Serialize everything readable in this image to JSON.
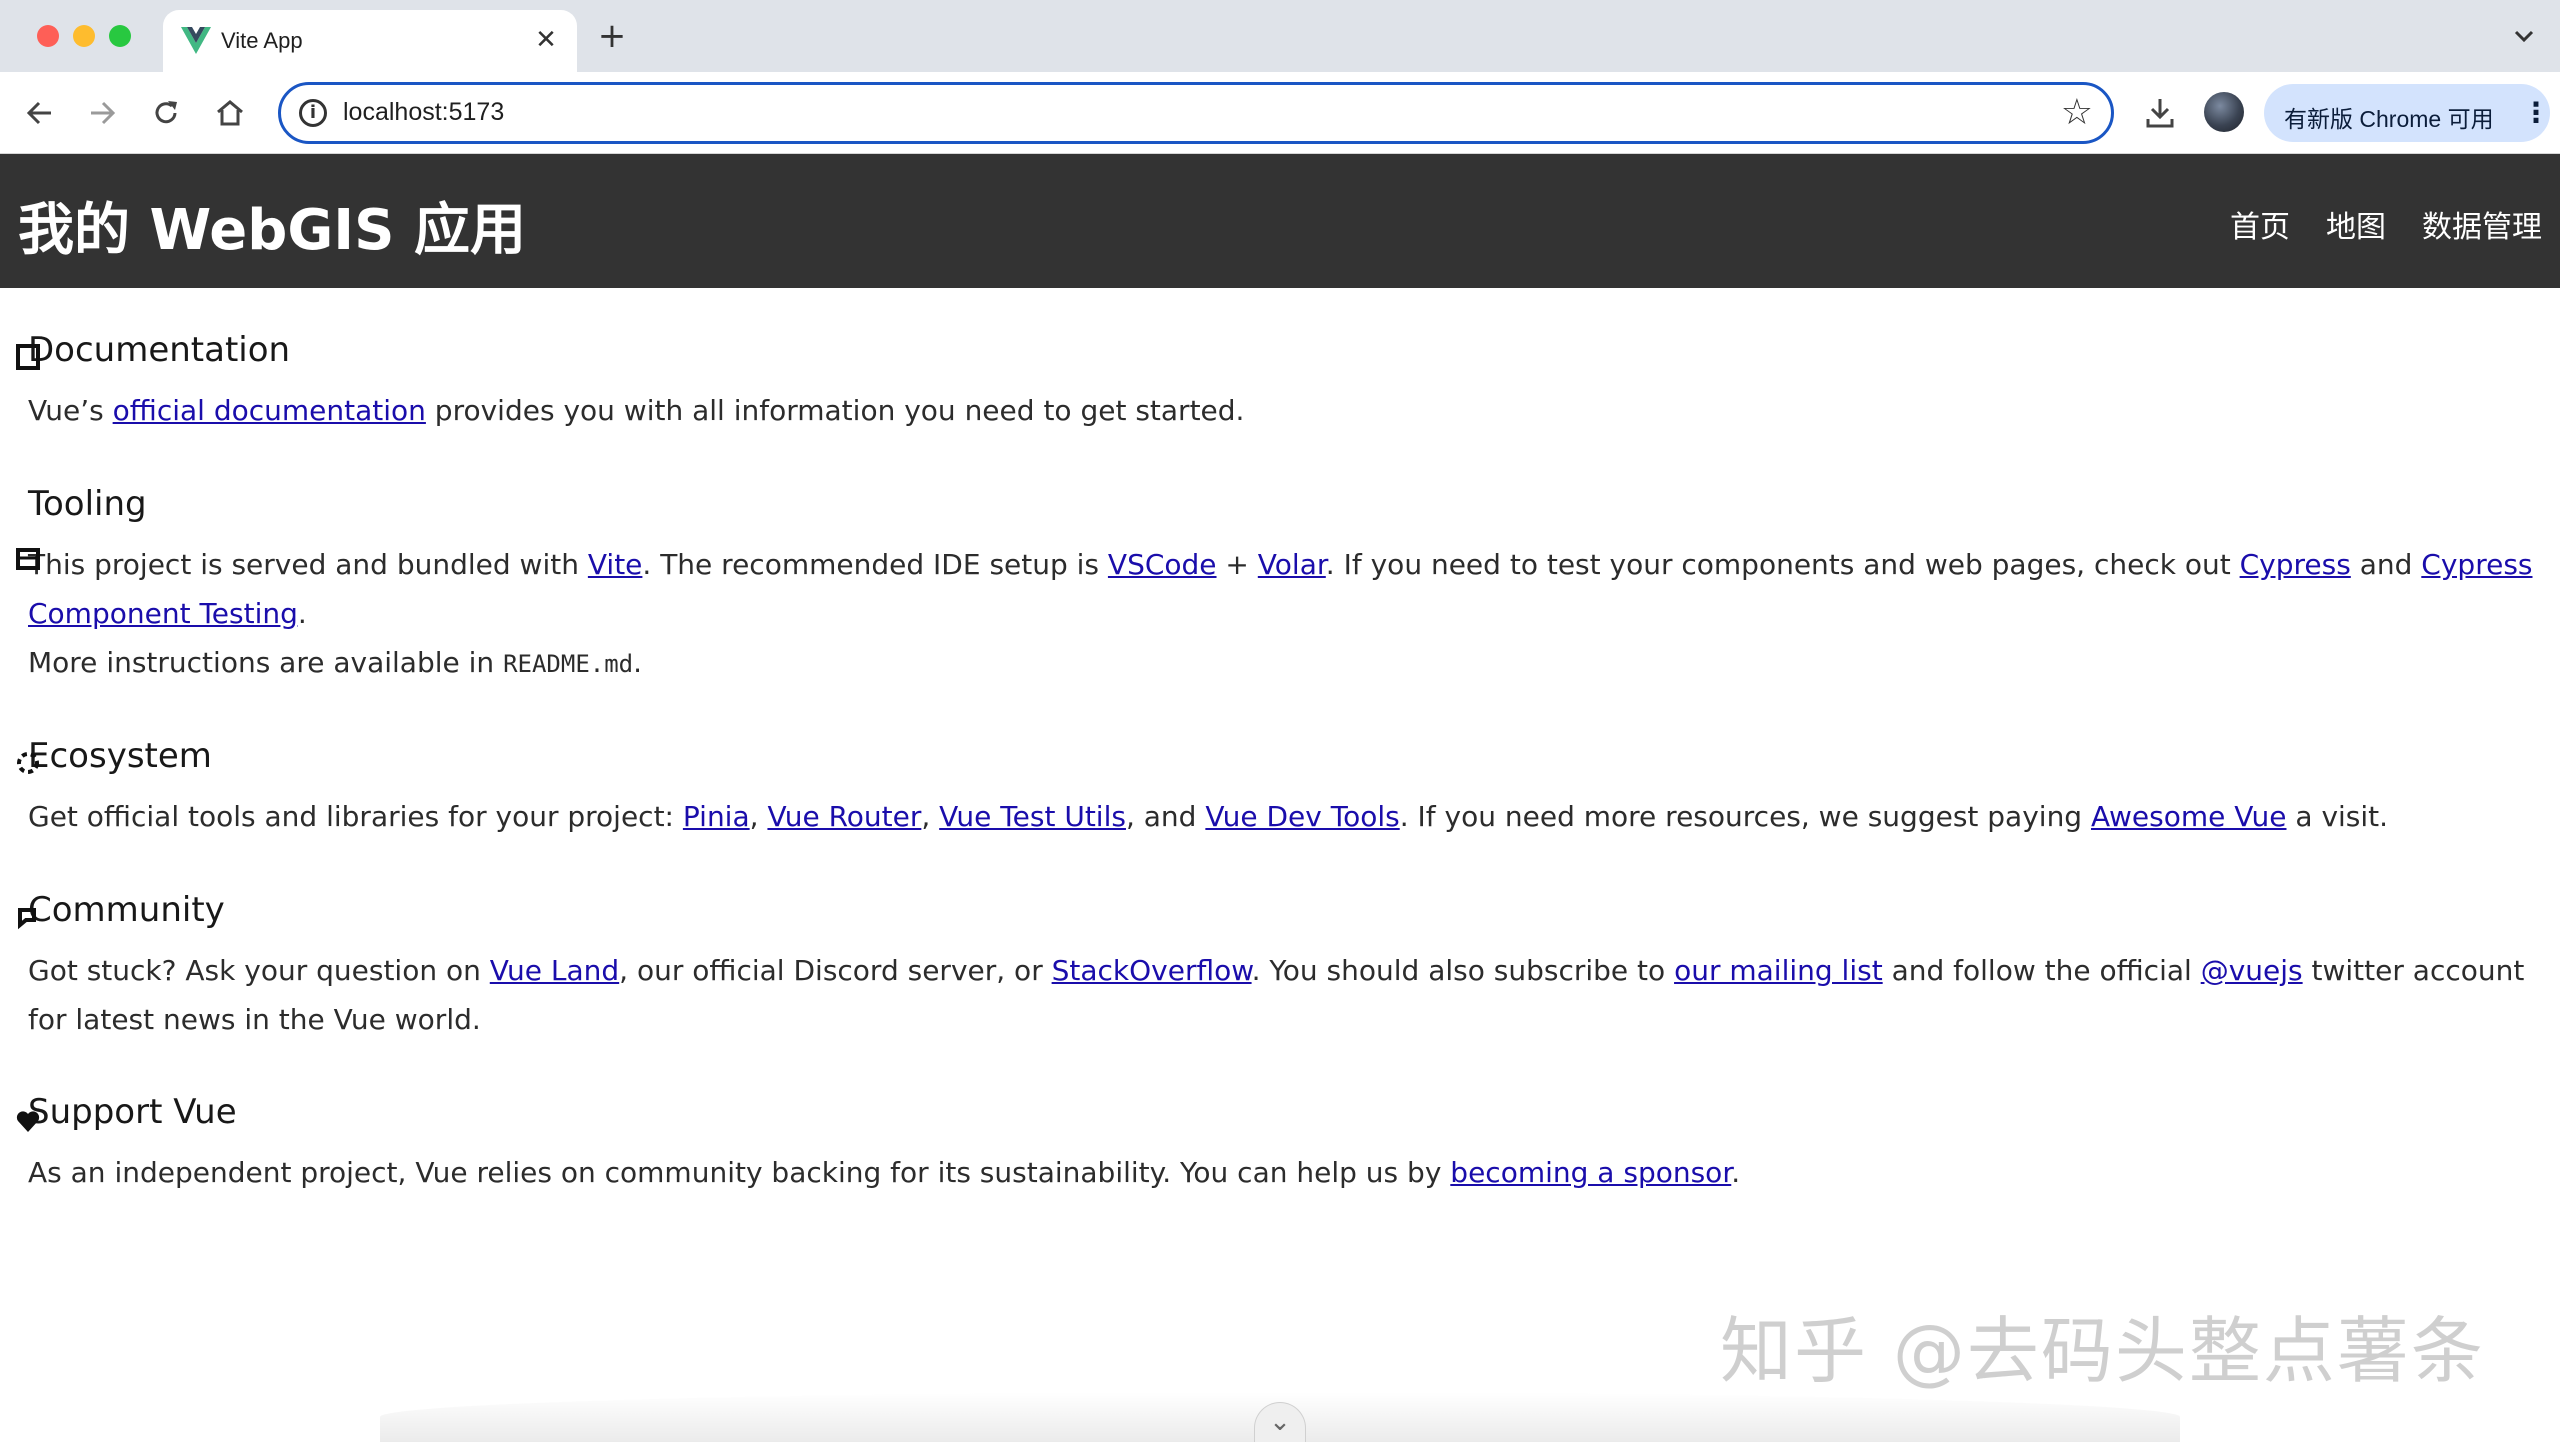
{
  "browser": {
    "tab_title": "Vite App",
    "tab_close": "✕",
    "new_tab": "+",
    "url": "localhost:5173",
    "update_button": "有新版 Chrome 可用",
    "update_menu": "⋮",
    "icons": [
      "vue-favicon",
      "back-arrow-icon",
      "forward-arrow-icon",
      "reload-icon",
      "home-icon",
      "info-icon",
      "star-icon",
      "download-icon",
      "profile-avatar",
      "tab-list-chevron-icon"
    ]
  },
  "app": {
    "title": "我的 WebGIS 应用",
    "nav": [
      "首页",
      "地图",
      "数据管理"
    ]
  },
  "sections": {
    "documentation": {
      "heading": "Documentation",
      "t1": "Vue’s ",
      "link1": "official documentation",
      "t2": " provides you with all information you need to get started."
    },
    "tooling": {
      "heading": "Tooling",
      "t1": "This project is served and bundled with ",
      "link_vite": "Vite",
      "t2": ". The recommended IDE setup is ",
      "link_vscode": "VSCode",
      "t3": " + ",
      "link_volar": "Volar",
      "t4": ". If you need to test your components and web pages, check out ",
      "link_cypress": "Cypress",
      "t5": " and ",
      "link_cypress_ct": "Cypress Component Testing",
      "t6": ".",
      "t7": "More instructions are available in ",
      "code": "README.md",
      "t8": "."
    },
    "ecosystem": {
      "heading": "Ecosystem",
      "t1": "Get official tools and libraries for your project: ",
      "link_pinia": "Pinia",
      "sep1": ", ",
      "link_router": "Vue Router",
      "sep2": ", ",
      "link_test_utils": "Vue Test Utils",
      "t2": ", and ",
      "link_devtools": "Vue Dev Tools",
      "t3": ". If you need more resources, we suggest paying ",
      "link_awesome": "Awesome Vue",
      "t4": " a visit."
    },
    "community": {
      "heading": "Community",
      "t1": "Got stuck? Ask your question on ",
      "link_vue_land": "Vue Land",
      "t2": ", our official Discord server, or ",
      "link_stackoverflow": "StackOverflow",
      "t3": ". You should also subscribe to ",
      "link_mailing": "our mailing list",
      "t4": " and follow the official ",
      "link_vuejs": "@vuejs",
      "t5": " twitter account for latest news in the Vue world."
    },
    "support": {
      "heading": "Support Vue",
      "t1": "As an independent project, Vue relies on community backing for its sustainability. You can help us by ",
      "link_sponsor": "becoming a sponsor",
      "t2": "."
    }
  },
  "watermark": "知乎 @去码头整点薯条",
  "scroll_hint": "⌄",
  "colors": {
    "header_bg": "#333333",
    "link": "#1a0dab",
    "omnibox_border": "#1a56c4",
    "update_bg": "#d3e3fd"
  }
}
